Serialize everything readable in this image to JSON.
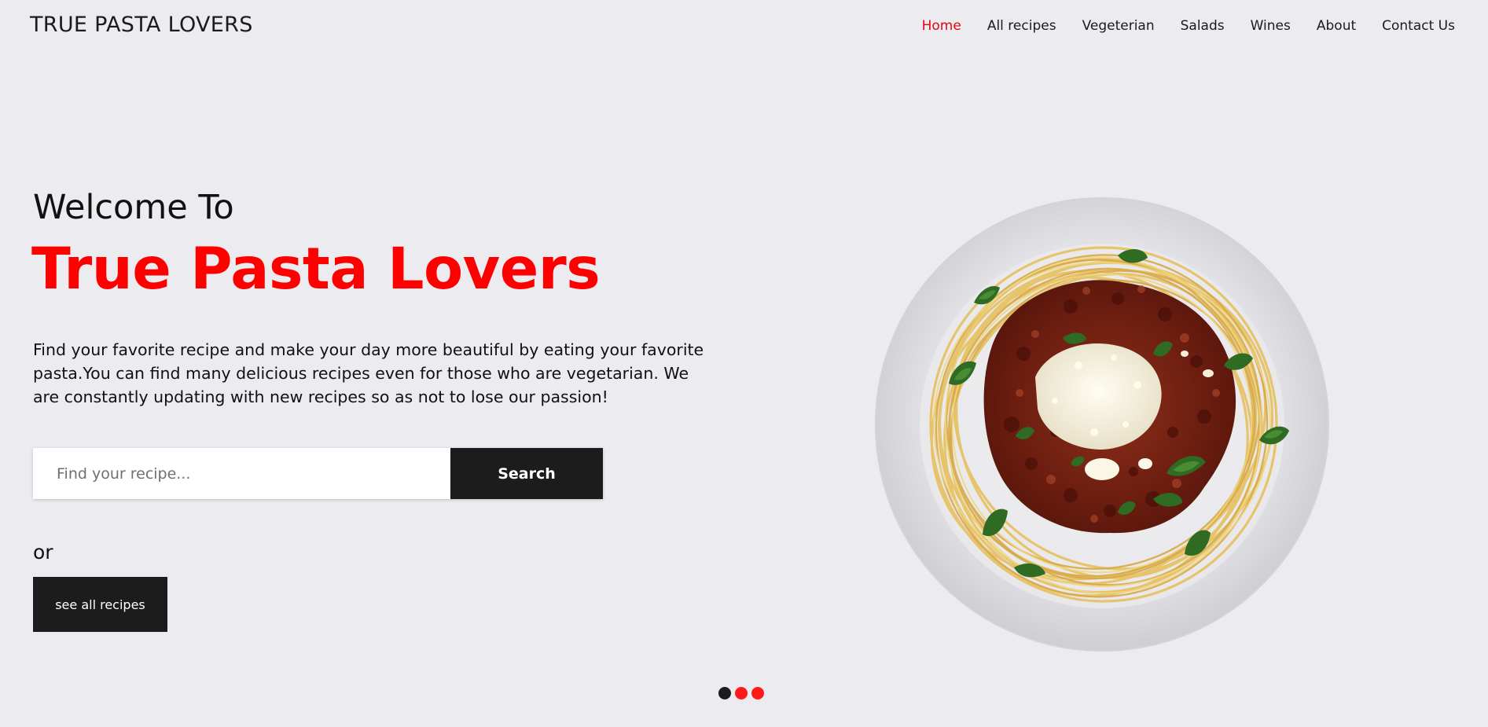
{
  "header": {
    "brand": "TRUE PASTA LOVERS",
    "nav": [
      {
        "label": "Home",
        "active": true
      },
      {
        "label": "All recipes",
        "active": false
      },
      {
        "label": "Vegeterian",
        "active": false
      },
      {
        "label": "Salads",
        "active": false
      },
      {
        "label": "Wines",
        "active": false
      },
      {
        "label": "About",
        "active": false
      },
      {
        "label": "Contact Us",
        "active": false
      }
    ]
  },
  "hero": {
    "welcome": "Welcome To",
    "title": "True Pasta Lovers",
    "description": "Find your favorite recipe and make your day more beautiful by eating your favorite pasta.You can find many delicious recipes even for those who are vegetarian. We are constantly updating with new recipes so as not to lose our passion!",
    "search": {
      "placeholder": "Find your recipe...",
      "value": "",
      "button_label": "Search"
    },
    "or_text": "or",
    "all_recipes_label": "see all recipes",
    "image": {
      "icon": "pasta-plate-image"
    }
  },
  "carousel": {
    "dots": [
      {
        "color": "#1c1c1c",
        "active": true
      },
      {
        "color": "#ff1a1a",
        "active": false
      },
      {
        "color": "#ff1a1a",
        "active": false
      }
    ]
  },
  "colors": {
    "accent": "#ff0000",
    "nav_active": "#e30613",
    "dark_button": "#1c1c1c",
    "background": "#ebebf0"
  }
}
